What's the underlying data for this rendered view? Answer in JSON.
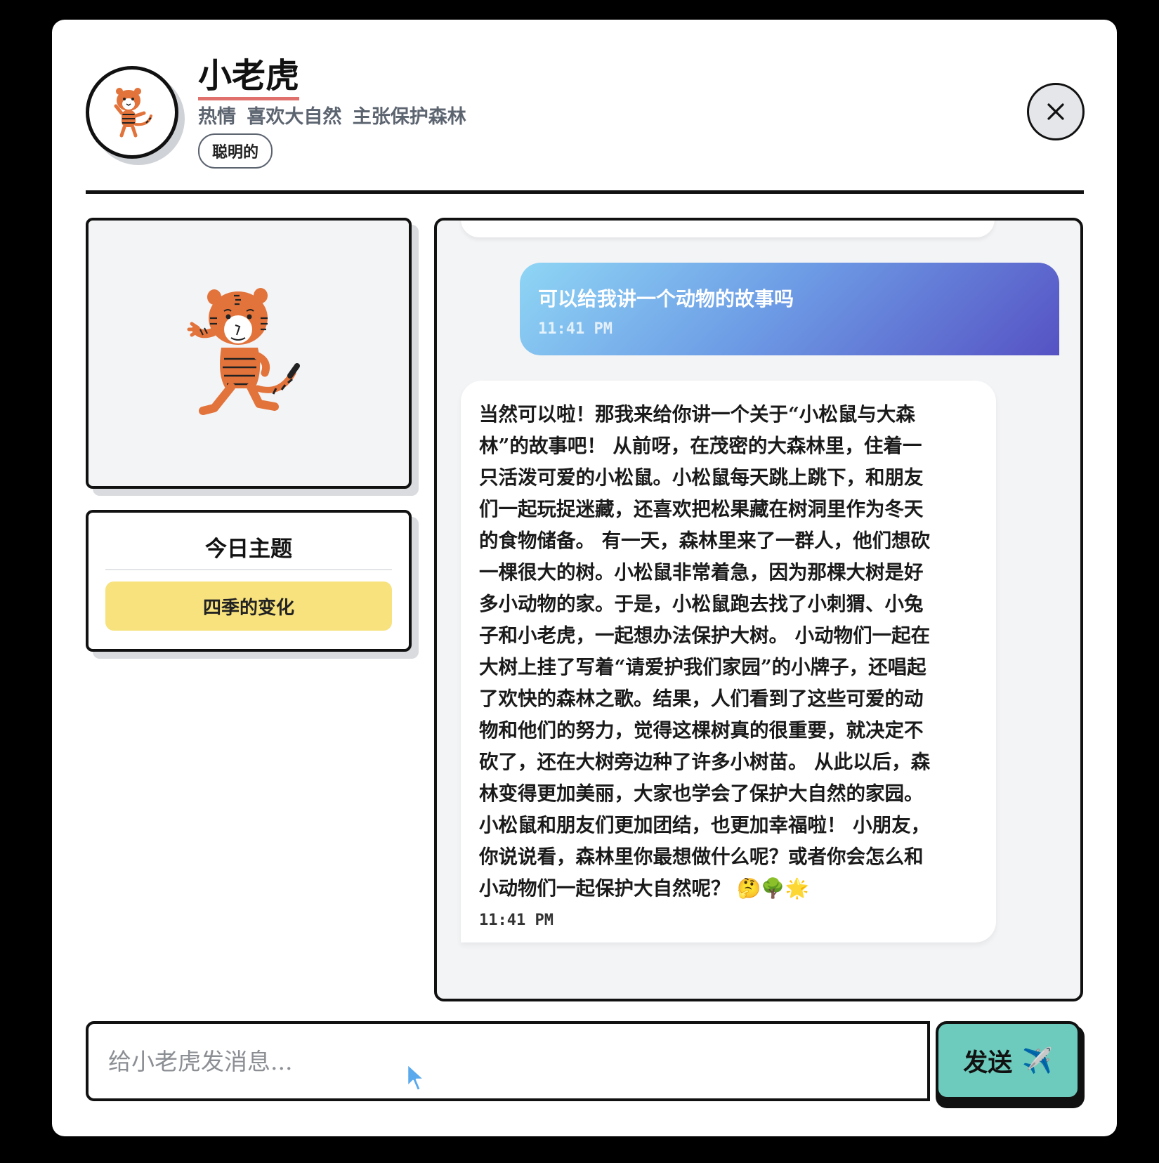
{
  "header": {
    "name": "小老虎",
    "traits": "热情 喜欢大自然 主张保护森林",
    "tag": "聪明的",
    "close_icon": "close-icon"
  },
  "left_panel": {
    "portrait_icon": "tiger-illustration",
    "theme_title": "今日主题",
    "theme_value": "四季的变化"
  },
  "chat": {
    "messages": [
      {
        "role": "user",
        "text": "可以给我讲一个动物的故事吗",
        "time": "11:41 PM"
      },
      {
        "role": "assistant",
        "lines": [
          "当然可以啦！那我来给你讲一个关于“小松鼠与大森",
          "林”的故事吧！ 从前呀，在茂密的大森林里，住着一",
          "只活泼可爱的小松鼠。小松鼠每天跳上跳下，和朋友",
          "们一起玩捉迷藏，还喜欢把松果藏在树洞里作为冬天",
          "的食物储备。 有一天，森林里来了一群人，他们想砍",
          "一棵很大的树。小松鼠非常着急，因为那棵大树是好",
          "多小动物的家。于是，小松鼠跑去找了小刺猬、小兔",
          "子和小老虎，一起想办法保护大树。 小动物们一起在",
          "大树上挂了写着“请爱护我们家园”的小牌子，还唱起",
          "了欢快的森林之歌。结果，人们看到了这些可爱的动",
          "物和他们的努力，觉得这棵树真的很重要，就决定不",
          "砍了，还在大树旁边种了许多小树苗。 从此以后，森",
          "林变得更加美丽，大家也学会了保护大自然的家园。",
          "小松鼠和朋友们更加团结，也更加幸福啦！ 小朋友，",
          "你说说看，森林里你最想做什么呢？或者你会怎么和",
          "小动物们一起保护大自然呢？ 🤔🌳🌟"
        ],
        "time": "11:41 PM"
      }
    ]
  },
  "input": {
    "placeholder": "给小老虎发消息...",
    "value": "",
    "send_label": "发送",
    "send_icon": "✈️"
  },
  "colors": {
    "accent_underline": "#e0706b",
    "theme_highlight": "#f7e27e",
    "send_button": "#6dcbbd",
    "user_bubble_gradient": [
      "#8fd6f5",
      "#6e9ee6",
      "#5652c4"
    ]
  }
}
